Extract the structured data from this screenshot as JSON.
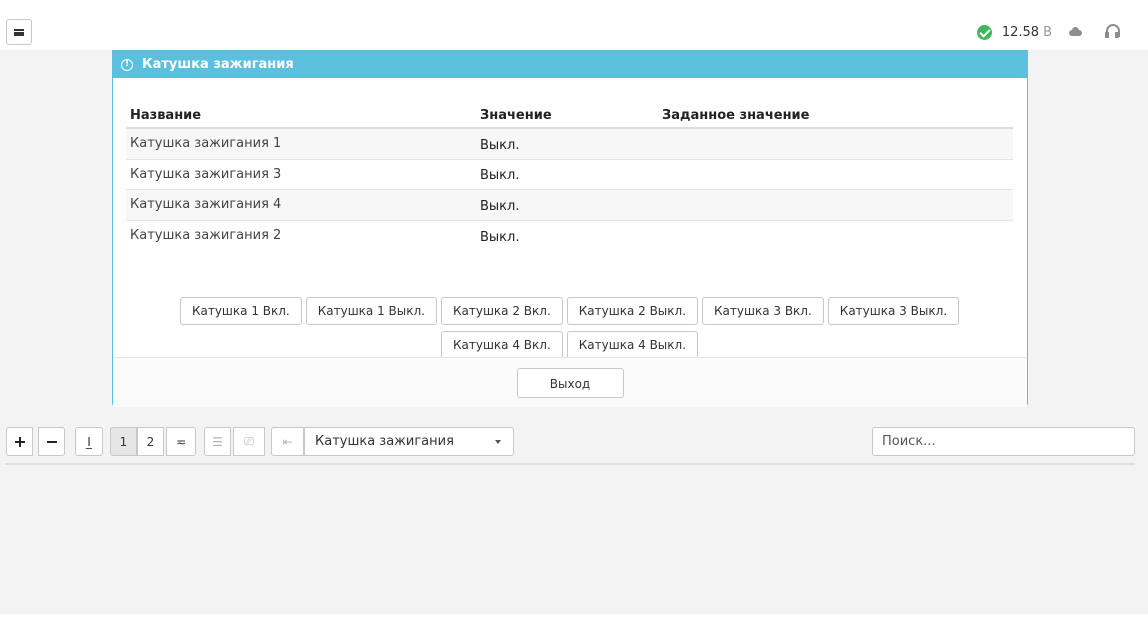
{
  "status": {
    "voltage": "12.58",
    "unit": "В"
  },
  "dialog": {
    "title": "Катушка зажигания",
    "columns": [
      "Название",
      "Значение",
      "Заданное значение"
    ],
    "rows": [
      {
        "name": "Катушка зажигания 1",
        "value": "Выкл.",
        "set": ""
      },
      {
        "name": "Катушка зажигания 3",
        "value": "Выкл.",
        "set": ""
      },
      {
        "name": "Катушка зажигания 4",
        "value": "Выкл.",
        "set": ""
      },
      {
        "name": "Катушка зажигания 2",
        "value": "Выкл.",
        "set": ""
      }
    ],
    "buttons": [
      "Катушка 1 Вкл.",
      "Катушка 1 Выкл.",
      "Катушка 2 Вкл.",
      "Катушка 2 Выкл.",
      "Катушка 3 Вкл.",
      "Катушка 3 Выкл.",
      "Катушка 4 Вкл.",
      "Катушка 4 Выкл."
    ],
    "exit_label": "Выход"
  },
  "toolbar": {
    "page1": "1",
    "page2": "2",
    "select_value": "Катушка зажигания",
    "search_placeholder": "Поиск..."
  }
}
